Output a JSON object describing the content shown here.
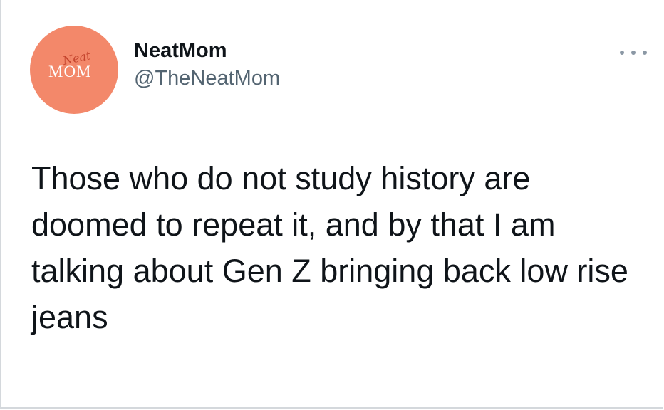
{
  "author": {
    "display_name": "NeatMom",
    "handle": "@TheNeatMom",
    "avatar": {
      "logo_script": "Neat",
      "logo_main": "MOM",
      "background_color": "#f3886a"
    }
  },
  "tweet": {
    "text": "Those who do not study history are doomed to repeat it, and by that I am talking about Gen Z bringing back low rise jeans"
  },
  "icons": {
    "more": "more-horizontal-icon"
  },
  "colors": {
    "text_primary": "#0f1419",
    "text_secondary": "#536471",
    "icon_gray": "#8b98a5"
  }
}
